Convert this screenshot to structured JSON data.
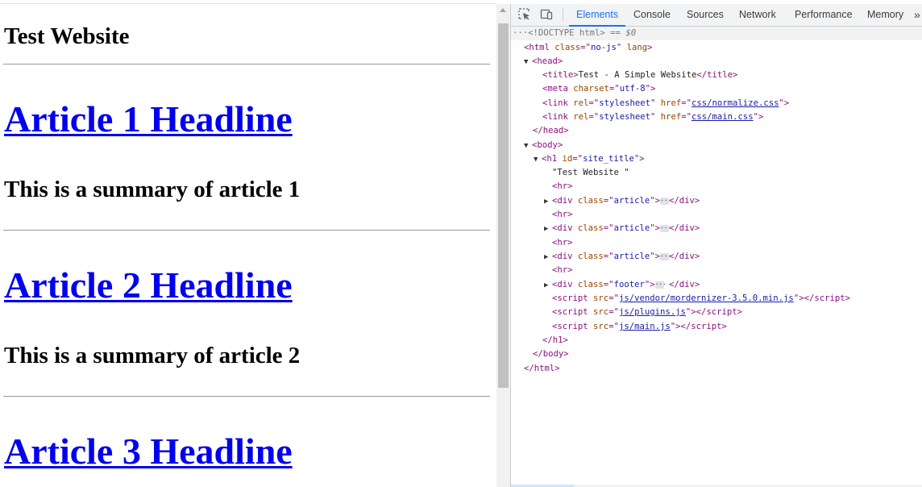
{
  "page": {
    "site_title": "Test Website",
    "articles": [
      {
        "headline": "Article 1 Headline",
        "summary": "This is a summary of article 1"
      },
      {
        "headline": "Article 2 Headline",
        "summary": "This is a summary of article 2"
      },
      {
        "headline": "Article 3 Headline"
      }
    ]
  },
  "devtools": {
    "tabs": [
      "Elements",
      "Console",
      "Sources",
      "Network",
      "Performance",
      "Memory"
    ],
    "active_tab": "Elements",
    "more_tabs_glyph": "»",
    "icons": {
      "inspect": "inspect-element-icon",
      "device": "device-toolbar-icon"
    },
    "colors": {
      "accent": "#1a73e8",
      "tag": "#881280",
      "attr": "#994500",
      "value": "#1a1aa6"
    }
  },
  "dom": {
    "doctype": "<!DOCTYPE html>",
    "selected_marker": "== $0",
    "html_class": "no-js",
    "title_text": "Test - A Simple Website",
    "charset": "utf-8",
    "css_normalize": "css/normalize.css",
    "css_main": "css/main.css",
    "h1_id": "site_title",
    "h1_text": "\"Test Website \"",
    "article_class": "article",
    "footer_class": "footer",
    "script_modernizr": "js/vendor/mordernizer-3.5.0.min.js",
    "script_plugins": "js/plugins.js",
    "script_main": "js/main.js"
  }
}
